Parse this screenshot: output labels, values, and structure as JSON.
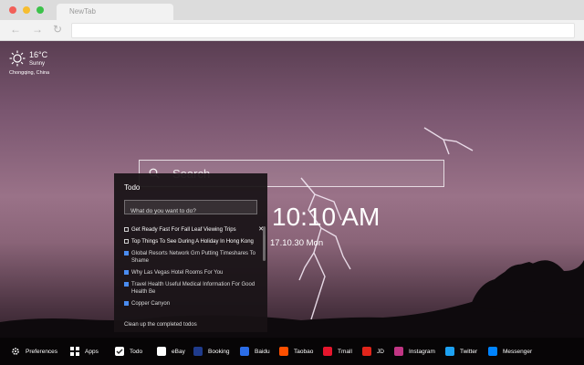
{
  "browser": {
    "tab_title": "NewTab",
    "nav": {
      "back": "←",
      "forward": "→",
      "reload": "↻"
    }
  },
  "weather": {
    "temperature": "16°C",
    "condition": "Sunny",
    "location": "Chongqing,  China"
  },
  "search": {
    "placeholder": "Search"
  },
  "clock": {
    "time": "10:10 AM",
    "date": "17.10.30 Mon"
  },
  "todo": {
    "title": "Todo",
    "input_placeholder": "What do you want to do?",
    "items": [
      {
        "text": "Get Ready Fast For Fall Leaf Viewing Trips",
        "done": false
      },
      {
        "text": "Top Things To See During A Holiday In Hong Kong",
        "done": false
      },
      {
        "text": "Global Resorts Network Grn Putting Timeshares To Shame",
        "done": true
      },
      {
        "text": "Why Las Vegas Hotel Rooms For You",
        "done": true
      },
      {
        "text": "Travel Health Useful Medical Information For Good Health Be",
        "done": true
      },
      {
        "text": "Copper Canyon",
        "done": true
      }
    ],
    "delete_glyph": "✕",
    "clear_label": "Clean up the completed todos"
  },
  "bottom_bar": {
    "items": [
      {
        "label": "Preferences",
        "icon": "gear-icon",
        "color": ""
      },
      {
        "label": "Apps",
        "icon": "grid-icon",
        "color": ""
      },
      {
        "label": "Todo",
        "icon": "checkbox-icon",
        "color": "#ffffff"
      },
      {
        "label": "eBay",
        "icon": "ebay-icon",
        "color": "#ffffff"
      },
      {
        "label": "Booking",
        "icon": "booking-icon",
        "color": "#1f3b8c"
      },
      {
        "label": "Baidu",
        "icon": "baidu-icon",
        "color": "#2b6de8"
      },
      {
        "label": "Taobao",
        "icon": "taobao-icon",
        "color": "#ff5000"
      },
      {
        "label": "Tmall",
        "icon": "tmall-icon",
        "color": "#e6162d"
      },
      {
        "label": "JD",
        "icon": "jd-icon",
        "color": "#e1251b"
      },
      {
        "label": "Instagram",
        "icon": "instagram-icon",
        "color": "#c13584"
      },
      {
        "label": "Twitter",
        "icon": "twitter-icon",
        "color": "#1da1f2"
      },
      {
        "label": "Messenger",
        "icon": "messenger-icon",
        "color": "#0084ff"
      }
    ]
  }
}
